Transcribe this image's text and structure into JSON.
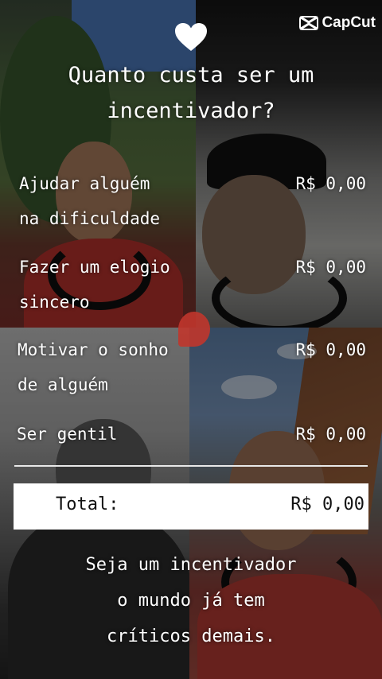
{
  "brand": {
    "name": "CapCut",
    "icon": "capcut-logo-icon"
  },
  "header": {
    "icon": "heart-icon",
    "title_lines": [
      "Quanto custa ser um",
      "incentivador?"
    ]
  },
  "items": [
    {
      "label_lines": [
        "Ajudar alguém",
        "na dificuldade"
      ],
      "price": "R$ 0,00"
    },
    {
      "label_lines": [
        "Fazer um elogio",
        "sincero"
      ],
      "price": "R$ 0,00"
    },
    {
      "label_lines": [
        "Motivar o sonho",
        "de alguém"
      ],
      "price": "R$ 0,00"
    },
    {
      "label_lines": [
        "Ser gentil"
      ],
      "price": "R$ 0,00"
    }
  ],
  "total": {
    "label": "Total:",
    "value": "R$ 0,00"
  },
  "footer": {
    "lines": [
      "Seja um incentivador",
      "o mundo já tem",
      "críticos demais."
    ]
  },
  "colors": {
    "text": "#ffffff",
    "total_box": "#ffffff",
    "total_text": "#111111"
  }
}
